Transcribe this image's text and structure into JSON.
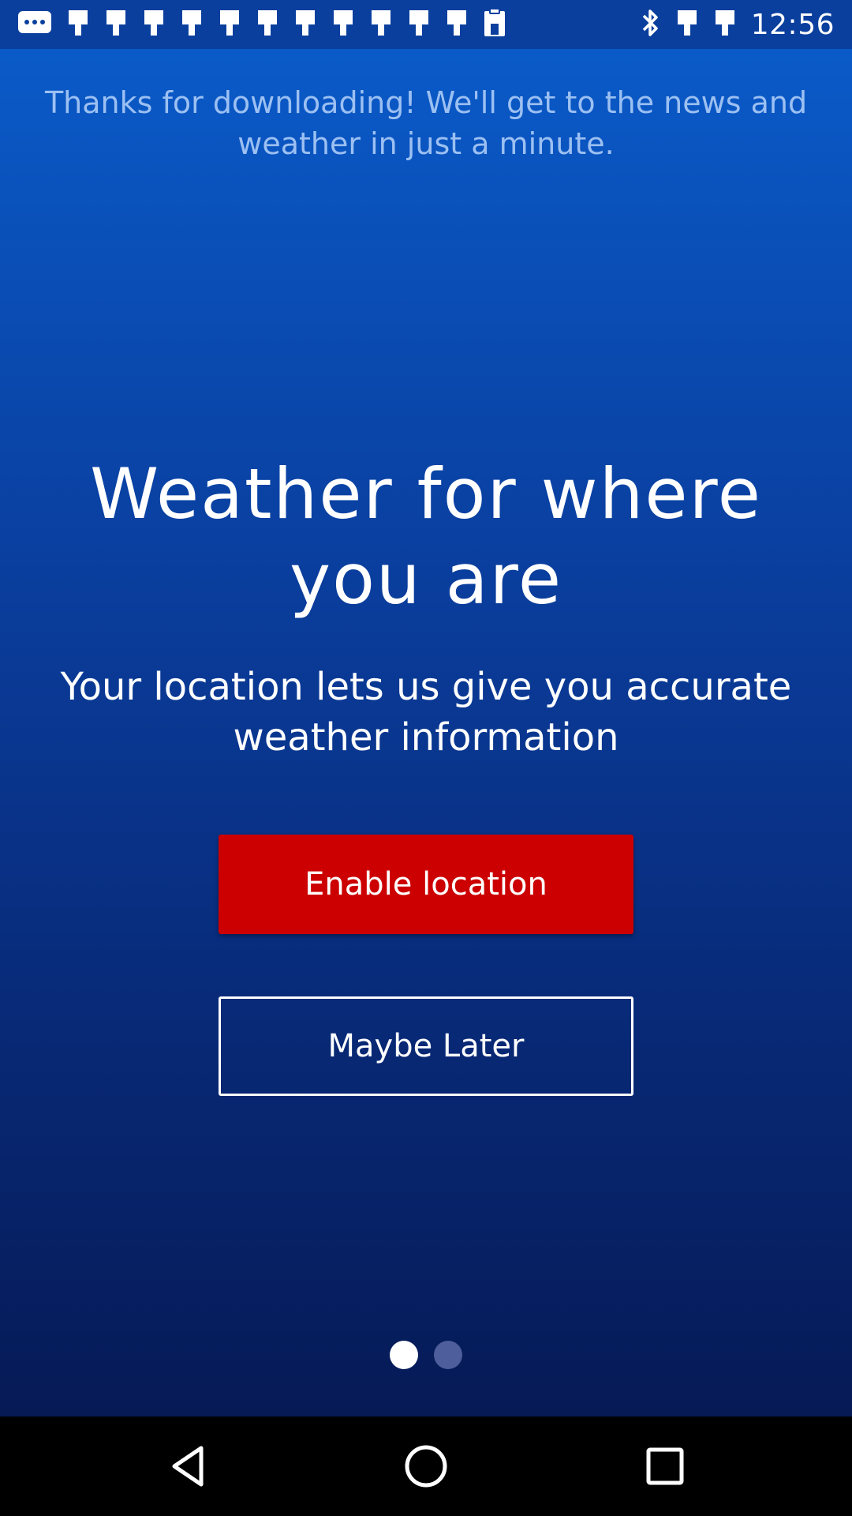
{
  "status_bar": {
    "time": "12:56",
    "left_icons": [
      "messages-icon",
      "notification-icon",
      "notification-icon",
      "notification-icon",
      "notification-icon",
      "notification-icon",
      "notification-icon",
      "notification-icon",
      "notification-icon",
      "notification-icon",
      "notification-icon",
      "notification-icon",
      "clipboard-icon"
    ],
    "right_icons": [
      "bluetooth-icon",
      "notification-icon",
      "notification-icon"
    ]
  },
  "onboarding": {
    "intro_text": "Thanks for downloading! We'll get to the news and weather in just a minute.",
    "headline": "Weather for where you are",
    "subheadline": "Your location lets us give you accurate weather information",
    "enable_button_label": "Enable location",
    "later_button_label": "Maybe Later",
    "page_indicator": {
      "current": 1,
      "total": 2
    }
  },
  "colors": {
    "background_top": "#0a5ac8",
    "background_bottom": "#061a56",
    "primary_button": "#cc0000",
    "intro_text": "#9cc0f2",
    "dot_active": "#ffffff",
    "dot_inactive": "#4e5e9c"
  },
  "nav_bar": {
    "icons": [
      "back-icon",
      "home-icon",
      "recents-icon"
    ]
  }
}
